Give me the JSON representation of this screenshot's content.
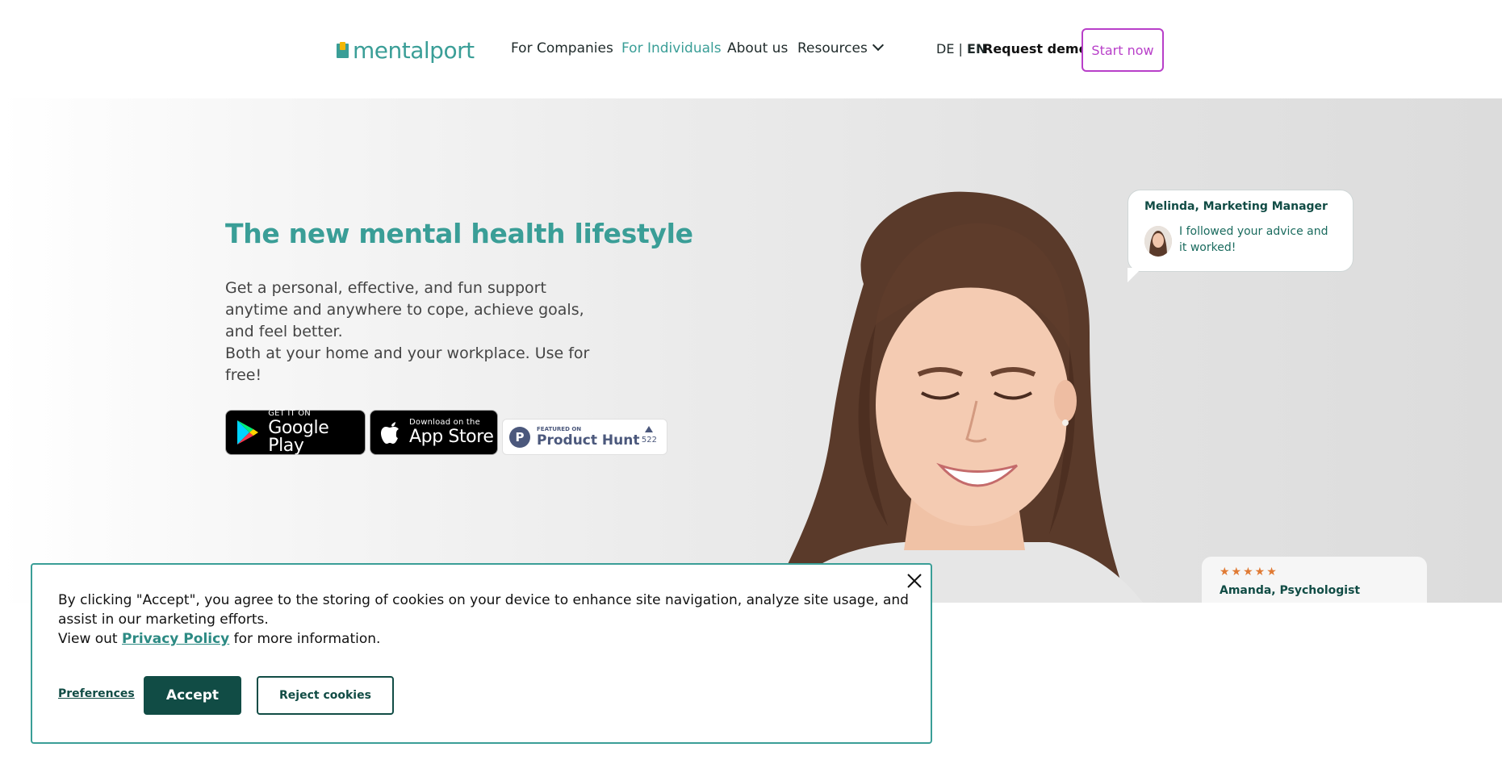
{
  "header": {
    "logo_text": "mentalport",
    "nav": [
      {
        "label": "For Companies"
      },
      {
        "label": "For Individuals"
      },
      {
        "label": "About us"
      },
      {
        "label": "Resources"
      }
    ],
    "lang_de": "DE",
    "lang_sep": "|",
    "lang_en": "EN",
    "request_demo": "Request demo",
    "start_now": "Start now"
  },
  "hero": {
    "title": "The new mental health lifestyle",
    "text_line1": "Get a personal, effective, and fun support anytime and anywhere to cope, achieve goals, and feel better.",
    "text_line2": "Both at your home and your workplace. Use for free!",
    "google_play": {
      "small": "GET IT ON",
      "big": "Google Play"
    },
    "app_store": {
      "small": "Download on the",
      "big": "App Store"
    },
    "product_hunt": {
      "small": "FEATURED ON",
      "big": "Product Hunt",
      "count": "522"
    }
  },
  "testimonial": {
    "name": "Melinda, Marketing Manager",
    "text": "I followed your advice and it worked!"
  },
  "review": {
    "stars": "★★★★★",
    "name": "Amanda, Psychologist"
  },
  "cookie_banner": {
    "text": "By clicking \"Accept\", you agree to the storing of cookies on your device to enhance site navigation, analyze site usage, and assist in our marketing efforts.",
    "view_prefix": "View out",
    "privacy_link": "Privacy Policy",
    "view_suffix": "for more information.",
    "preferences": "Preferences",
    "accept": "Accept",
    "reject": "Reject cookies"
  },
  "colors": {
    "brand_teal": "#3a9e97",
    "dark_teal": "#114c45",
    "start_now_purple": "#b83fc9"
  }
}
